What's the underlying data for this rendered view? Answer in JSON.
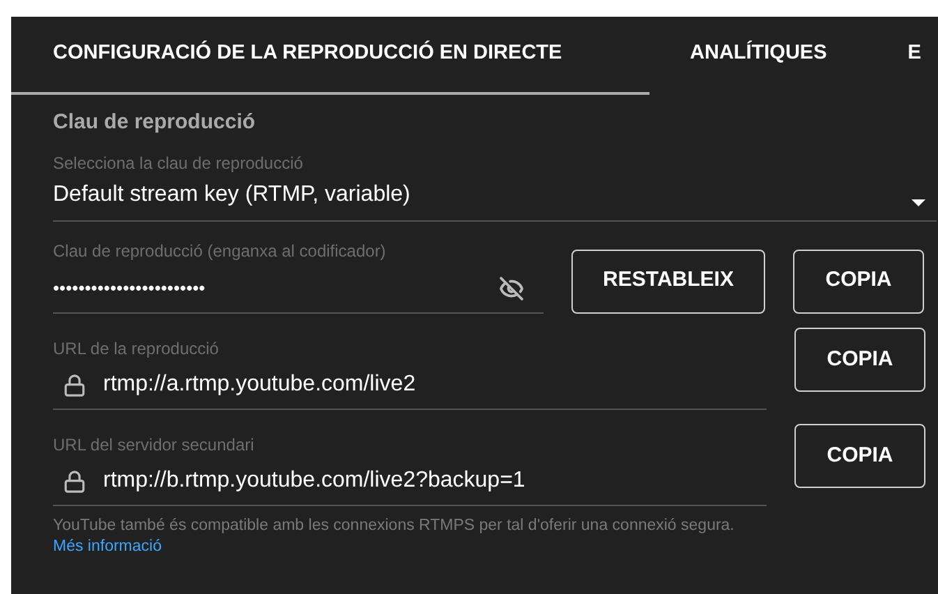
{
  "tabs": [
    {
      "label": "CONFIGURACIÓ DE LA REPRODUCCIÓ EN DIRECTE",
      "selected": true
    },
    {
      "label": "ANALÍTIQUES",
      "selected": false
    },
    {
      "label": "E",
      "selected": false
    }
  ],
  "section_title": "Clau de reproducció",
  "stream_key_select": {
    "label": "Selecciona la clau de reproducció",
    "value": "Default stream key (RTMP, variable)"
  },
  "stream_key": {
    "label": "Clau de reproducció (enganxa al codificador)",
    "value": "••••••••••••••••••••••••",
    "hidden": true,
    "buttons": [
      "RESTABLEIX",
      "COPIA"
    ]
  },
  "url_fields": [
    {
      "label": "URL de la reproducció",
      "value": "rtmp://a.rtmp.youtube.com/live2",
      "button": "COPIA"
    },
    {
      "label": "URL del servidor secundari",
      "value": "rtmp://b.rtmp.youtube.com/live2?backup=1",
      "button": "COPIA"
    }
  ],
  "note": "YouTube també és compatible amb les connexions RTMPS per tal d'oferir una connexió segura.",
  "link": "Més informació"
}
